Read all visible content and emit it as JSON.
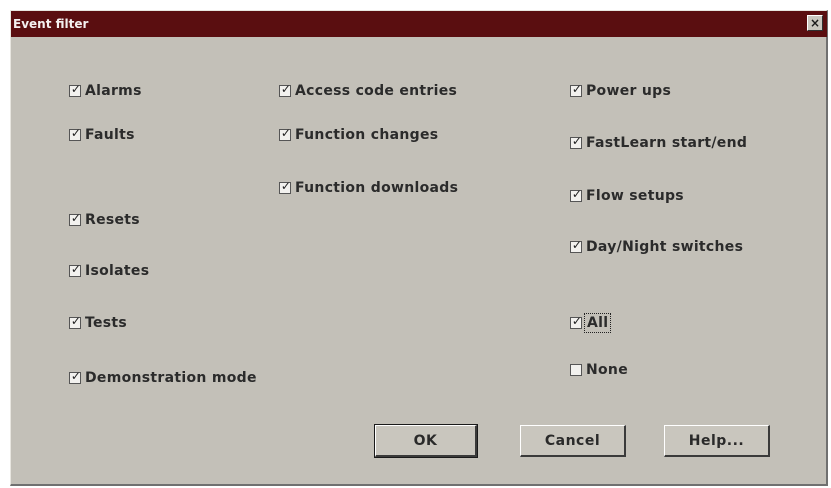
{
  "window": {
    "title": "Event filter",
    "close_glyph": "×"
  },
  "checkboxes": {
    "alarms": {
      "label": "Alarms",
      "checked": true
    },
    "faults": {
      "label": "Faults",
      "checked": true
    },
    "resets": {
      "label": "Resets",
      "checked": true
    },
    "isolates": {
      "label": "Isolates",
      "checked": true
    },
    "tests": {
      "label": "Tests",
      "checked": true
    },
    "demonstration_mode": {
      "label": "Demonstration mode",
      "checked": true
    },
    "access_code_entries": {
      "label": "Access code entries",
      "checked": true
    },
    "function_changes": {
      "label": "Function changes",
      "checked": true
    },
    "function_downloads": {
      "label": "Function downloads",
      "checked": true
    },
    "power_ups": {
      "label": "Power ups",
      "checked": true
    },
    "fastlearn": {
      "label": "FastLearn start/end",
      "checked": true
    },
    "flow_setups": {
      "label": "Flow setups",
      "checked": true
    },
    "day_night_switches": {
      "label": "Day/Night switches",
      "checked": true
    },
    "all": {
      "label": "All",
      "checked": true
    },
    "none": {
      "label": "None",
      "checked": false
    }
  },
  "buttons": {
    "ok": "OK",
    "cancel": "Cancel",
    "help": "Help..."
  },
  "check_glyph": "✓",
  "colors": {
    "titlebar": "#5a0e10",
    "dialog_bg": "#c3c0b8"
  }
}
